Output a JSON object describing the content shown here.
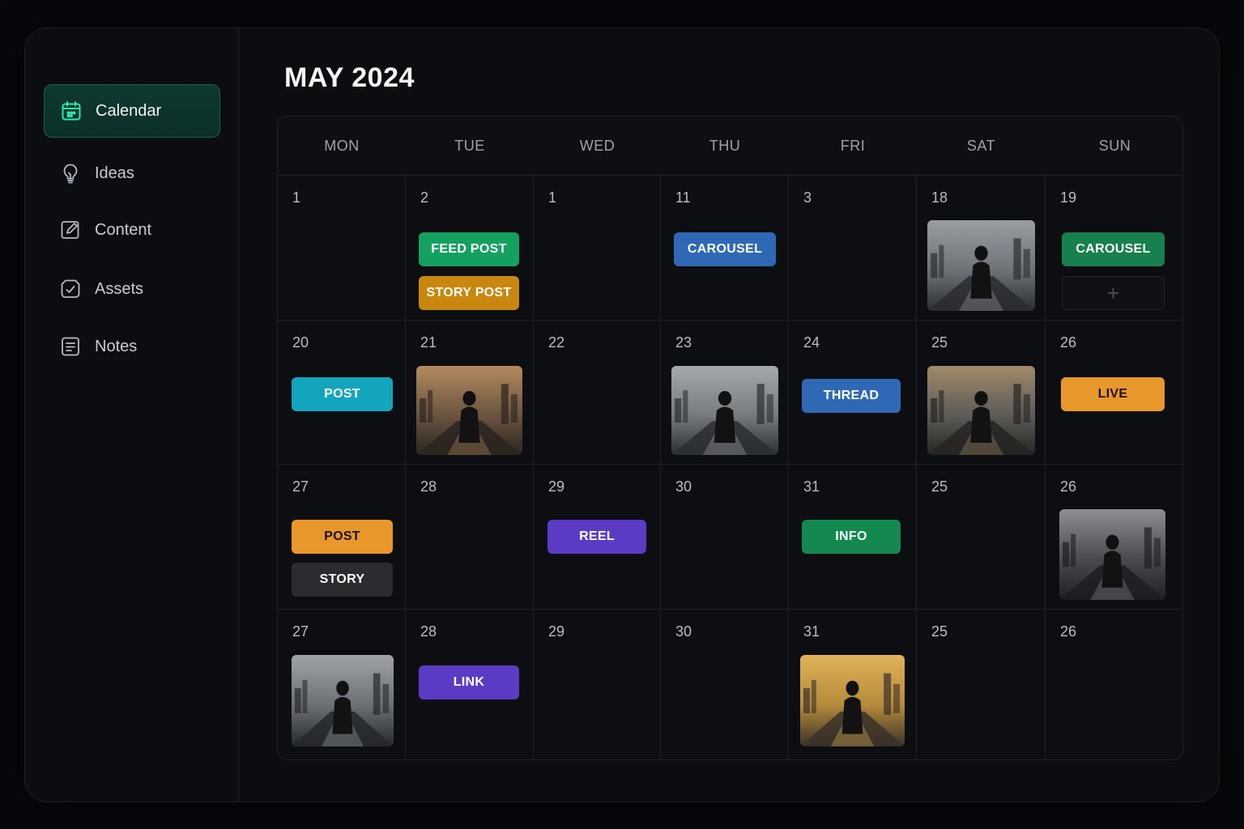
{
  "sidebar": {
    "items": [
      {
        "label": "Calendar",
        "icon": "calendar-icon",
        "active": true
      },
      {
        "label": "Ideas",
        "icon": "lightbulb-icon",
        "active": false
      },
      {
        "label": "Content",
        "icon": "edit-square-icon",
        "active": false
      },
      {
        "label": "Assets",
        "icon": "badge-check-icon",
        "active": false
      },
      {
        "label": "Notes",
        "icon": "notes-icon",
        "active": false
      }
    ],
    "accent": "#2ee6b0"
  },
  "calendar": {
    "title": "MAY 2024",
    "weekdays": [
      "MON",
      "TUE",
      "WED",
      "THU",
      "FRI",
      "SAT",
      "SUN"
    ],
    "weeks": [
      [
        {
          "day": "1",
          "items": []
        },
        {
          "day": "2",
          "items": [
            {
              "kind": "tag",
              "label": "FEED POST",
              "color": "#14a160"
            },
            {
              "kind": "tag",
              "label": "STORY POST",
              "color": "#c9870f"
            }
          ]
        },
        {
          "day": "1",
          "items": []
        },
        {
          "day": "11",
          "items": [
            {
              "kind": "tag",
              "label": "CAROUSEL",
              "color": "#2f69b5"
            }
          ]
        },
        {
          "day": "3",
          "items": []
        },
        {
          "day": "18",
          "items": [
            {
              "kind": "image",
              "label": "hooded-figure-photo"
            }
          ]
        },
        {
          "day": "19",
          "items": [
            {
              "kind": "tag",
              "label": "CAROUSEL",
              "color": "#17804e"
            },
            {
              "kind": "add",
              "label": "+"
            }
          ]
        }
      ],
      [
        {
          "day": "20",
          "items": [
            {
              "kind": "tag",
              "label": "POST",
              "color": "#13a5bd"
            }
          ]
        },
        {
          "day": "21",
          "items": [
            {
              "kind": "image",
              "label": "figure-sunset-photo"
            }
          ]
        },
        {
          "day": "22",
          "items": []
        },
        {
          "day": "23",
          "items": [
            {
              "kind": "image",
              "label": "figure-rooftop-photo"
            }
          ]
        },
        {
          "day": "24",
          "items": [
            {
              "kind": "tag",
              "label": "THREAD",
              "color": "#2f69b5"
            }
          ]
        },
        {
          "day": "25",
          "items": [
            {
              "kind": "image",
              "label": "figure-dusk-photo"
            }
          ]
        },
        {
          "day": "26",
          "items": [
            {
              "kind": "tag",
              "label": "LIVE",
              "color": "#e8972b",
              "text_color": "#1a1206"
            }
          ]
        }
      ],
      [
        {
          "day": "27",
          "items": [
            {
              "kind": "tag",
              "label": "POST",
              "color": "#e8972b",
              "text_color": "#1a1206"
            },
            {
              "kind": "tag",
              "label": "STORY",
              "color": "#2b2c30"
            }
          ]
        },
        {
          "day": "28",
          "items": []
        },
        {
          "day": "29",
          "items": [
            {
              "kind": "tag",
              "label": "REEL",
              "color": "#5b3bc4"
            }
          ]
        },
        {
          "day": "30",
          "items": []
        },
        {
          "day": "31",
          "items": [
            {
              "kind": "tag",
              "label": "INFO",
              "color": "#14894f"
            }
          ]
        },
        {
          "day": "25",
          "items": []
        },
        {
          "day": "26",
          "items": [
            {
              "kind": "image",
              "label": "hooded-woman-photo"
            }
          ]
        }
      ],
      [
        {
          "day": "27",
          "items": [
            {
              "kind": "image",
              "label": "figure-city-photo"
            }
          ]
        },
        {
          "day": "28",
          "items": [
            {
              "kind": "tag",
              "label": "LINK",
              "color": "#5b3bc4"
            }
          ]
        },
        {
          "day": "29",
          "items": []
        },
        {
          "day": "30",
          "items": []
        },
        {
          "day": "31",
          "items": [
            {
              "kind": "image",
              "label": "figure-golden-sky-photo"
            }
          ]
        },
        {
          "day": "25",
          "items": []
        },
        {
          "day": "26",
          "items": []
        }
      ]
    ]
  }
}
